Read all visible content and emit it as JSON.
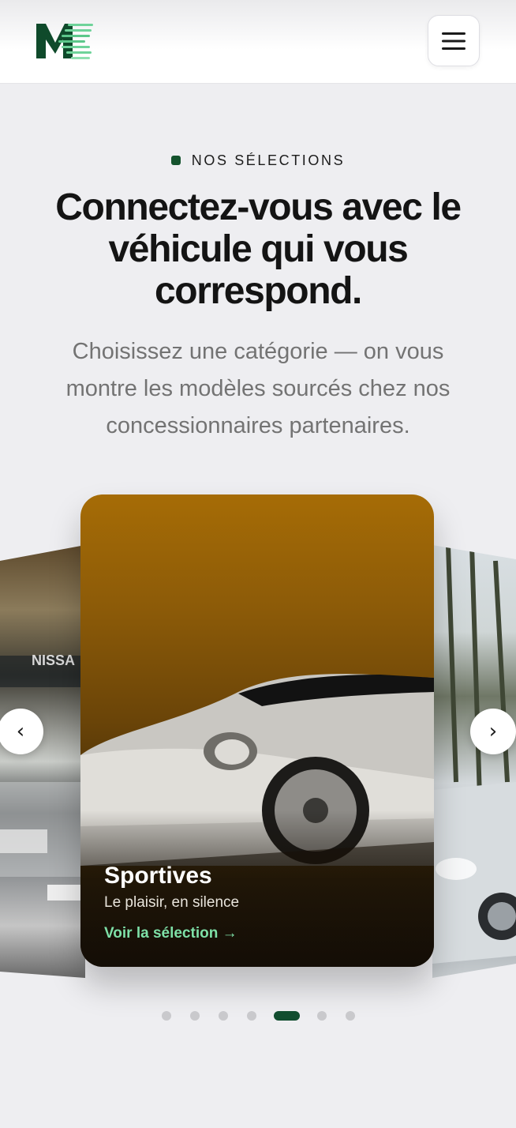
{
  "header": {
    "logo_letter": "M",
    "menu_icon": "hamburger-icon"
  },
  "hero": {
    "eyebrow": "NOS SÉLECTIONS",
    "title": "Connectez-vous avec le véhicule qui vous correspond.",
    "subtitle": "Choisissez une catégorie — on vous montre les modèles sourcés chez nos concessionnaires partenaires."
  },
  "carousel": {
    "active_card": {
      "title": "Sportives",
      "description": "Le plaisir, en silence",
      "link": "Voir la sélection →"
    },
    "prev_label": "‹",
    "next_label": "›",
    "slide_count": 7,
    "active_index": 4
  },
  "colors": {
    "brand": "#14532d",
    "link": "#7ee0a7",
    "background": "#eeeef1"
  }
}
